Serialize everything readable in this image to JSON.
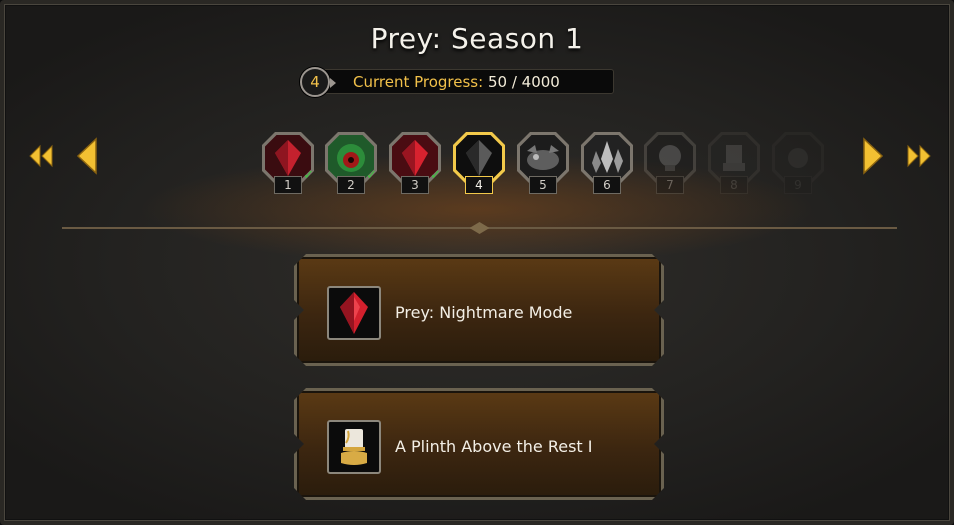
{
  "window": {
    "title": "Prey: Season 1"
  },
  "progress": {
    "level": "4",
    "label": "Current Progress:",
    "value": "50 / 4000",
    "fraction": 0.0125
  },
  "tiers": [
    {
      "number": "1",
      "icon": "red-crystal-icon",
      "state": "completed"
    },
    {
      "number": "2",
      "icon": "green-eye-icon",
      "state": "completed"
    },
    {
      "number": "3",
      "icon": "red-crystal-icon",
      "state": "completed"
    },
    {
      "number": "4",
      "icon": "dark-crystal-icon",
      "state": "current"
    },
    {
      "number": "5",
      "icon": "creature-icon",
      "state": "locked"
    },
    {
      "number": "6",
      "icon": "crystal-cluster-icon",
      "state": "locked"
    },
    {
      "number": "7",
      "icon": "orb-icon",
      "state": "locked"
    },
    {
      "number": "8",
      "icon": "plinth-icon",
      "state": "locked"
    },
    {
      "number": "9",
      "icon": "unknown-icon",
      "state": "locked"
    }
  ],
  "rewards": [
    {
      "label": "Prey: Nightmare Mode",
      "icon": "red-crystal-icon"
    },
    {
      "label": "A Plinth Above the Rest I",
      "icon": "plinth-icon"
    }
  ],
  "colors": {
    "accent_gold": "#f2c94a",
    "check_green": "#3ec43e",
    "reward_bg": "#4a2f12"
  }
}
